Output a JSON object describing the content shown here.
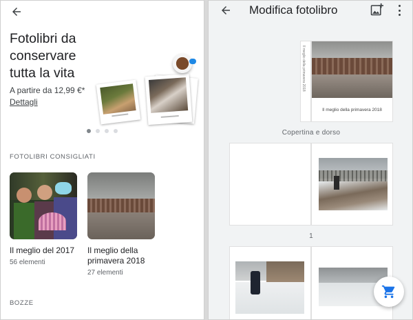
{
  "left": {
    "hero": {
      "title": "Fotolibri da conservare tutta la vita",
      "price": "A partire da 12,99 €*",
      "details_link": "Dettagli"
    },
    "carousel": {
      "total": 4,
      "active": 1
    },
    "recommended": {
      "label": "FOTOLIBRI CONSIGLIATI",
      "albums": [
        {
          "title": "Il meglio del 2017",
          "count": "56 elementi"
        },
        {
          "title": "Il meglio della primavera 2018",
          "count": "27 elementi"
        }
      ]
    },
    "drafts_label": "BOZZE"
  },
  "right": {
    "title": "Modifica fotolibro",
    "cover": {
      "caption": "Il meglio della primavera 2018",
      "spine_text": "Il meglio della primavera 2018"
    },
    "cover_label": "Copertina e dorso",
    "spread_number": "1"
  },
  "colors": {
    "accent": "#1a73e8",
    "text": "#202124",
    "muted": "#5f6368"
  },
  "icons": [
    "arrow-back-icon",
    "add-photo-icon",
    "more-vert-icon",
    "cart-icon"
  ]
}
